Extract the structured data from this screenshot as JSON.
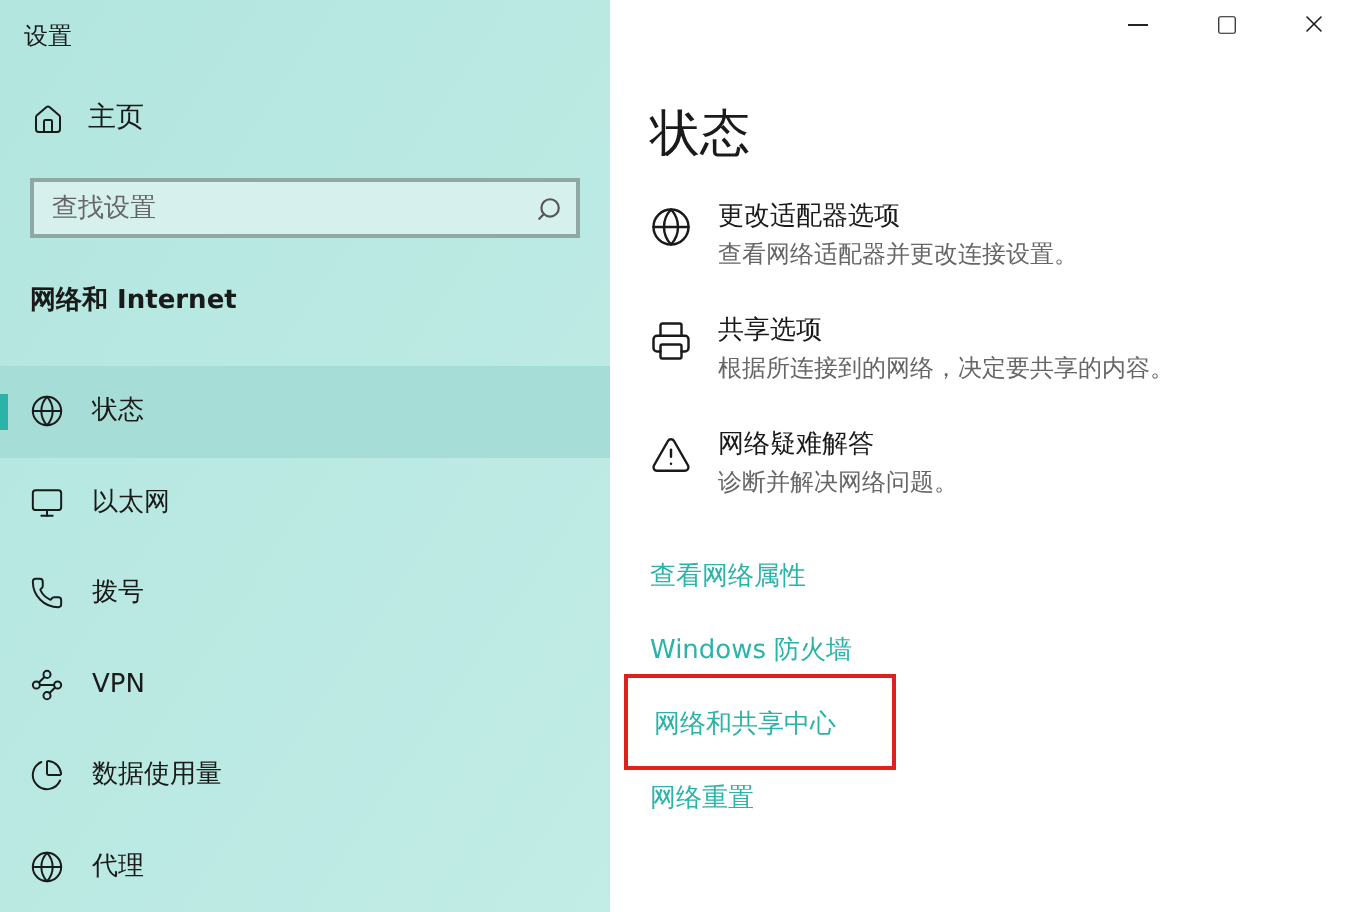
{
  "window": {
    "title": "设置",
    "controls": [
      {
        "kind": "minimize"
      },
      {
        "kind": "maximize"
      },
      {
        "kind": "close"
      }
    ]
  },
  "sidebar": {
    "home": "主页",
    "search": {
      "placeholder": "查找设置"
    },
    "section": "网络和 Internet",
    "items": [
      {
        "label": "状态",
        "selected": true
      },
      {
        "label": "以太网",
        "selected": false
      },
      {
        "label": "拨号",
        "selected": false
      },
      {
        "label": "VPN",
        "selected": false
      },
      {
        "label": "数据使用量",
        "selected": false
      },
      {
        "label": "代理",
        "selected": false
      }
    ]
  },
  "main": {
    "heading": "状态",
    "options": [
      {
        "title": "更改适配器选项",
        "description": "查看网络适配器并更改连接设置。"
      },
      {
        "title": "共享选项",
        "description": "根据所连接到的网络，决定要共享的内容。"
      },
      {
        "title": "网络疑难解答",
        "description": "诊断并解决网络问题。"
      }
    ],
    "links": [
      {
        "label": "查看网络属性",
        "highlighted": false
      },
      {
        "label": "Windows 防火墙",
        "highlighted": false
      },
      {
        "label": "网络和共享中心",
        "highlighted": true
      },
      {
        "label": "网络重置",
        "highlighted": false
      }
    ]
  }
}
